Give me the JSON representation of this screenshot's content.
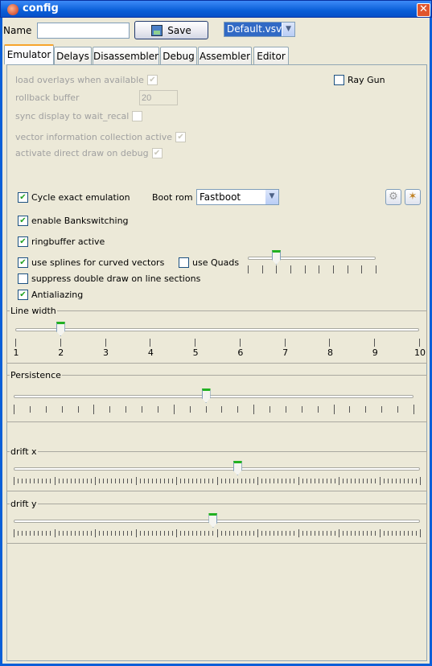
{
  "window": {
    "title": "config",
    "close_icon": "close-icon"
  },
  "toolbar": {
    "name_label": "Name",
    "name_value": "",
    "save_label": "Save",
    "file_selected": "Default.vsv"
  },
  "tabs": [
    "Emulator",
    "Delays",
    "Disassembler",
    "Debug",
    "Assembler",
    "Editor"
  ],
  "selected_tab": "Emulator",
  "disabled_options": {
    "load_overlays": {
      "label": "load overlays when available",
      "checked": true
    },
    "rollback": {
      "label": "rollback buffer",
      "value": "20"
    },
    "sync_display": {
      "label": "sync display to wait_recal",
      "checked": false
    },
    "vector_info": {
      "label": "vector information collection active",
      "checked": true
    },
    "direct_draw": {
      "label": "activate direct draw on debug",
      "checked": true
    }
  },
  "ray_gun": {
    "label": "Ray Gun",
    "checked": false
  },
  "options": {
    "cycle_exact": {
      "label": "Cycle exact emulation",
      "checked": true
    },
    "boot_rom_label": "Boot rom",
    "boot_rom_value": "Fastboot",
    "bankswitching": {
      "label": "enable Bankswitching",
      "checked": true
    },
    "ringbuffer": {
      "label": "ringbuffer active",
      "checked": true
    },
    "splines": {
      "label": "use splines for curved vectors",
      "checked": true
    },
    "quads": {
      "label": "use Quads",
      "checked": false
    },
    "suppress": {
      "label": "suppress double draw on line sections",
      "checked": false
    },
    "antialiazing": {
      "label": "Antialiazing",
      "checked": true
    }
  },
  "quads_slider": {
    "ticks": 10,
    "value_fraction": 0.22
  },
  "line_width": {
    "title": "Line width",
    "labels": [
      "1",
      "2",
      "3",
      "4",
      "5",
      "6",
      "7",
      "8",
      "9",
      "10"
    ],
    "value": 2
  },
  "persistence": {
    "title": "Persistence",
    "ticks": 26,
    "value_fraction": 0.48
  },
  "drift_x": {
    "title": "drift x",
    "value_fraction": 0.55
  },
  "drift_y": {
    "title": "drift y",
    "value_fraction": 0.49
  },
  "icons": {
    "settings": "gear-icon",
    "wizard": "magic-wand-icon"
  }
}
